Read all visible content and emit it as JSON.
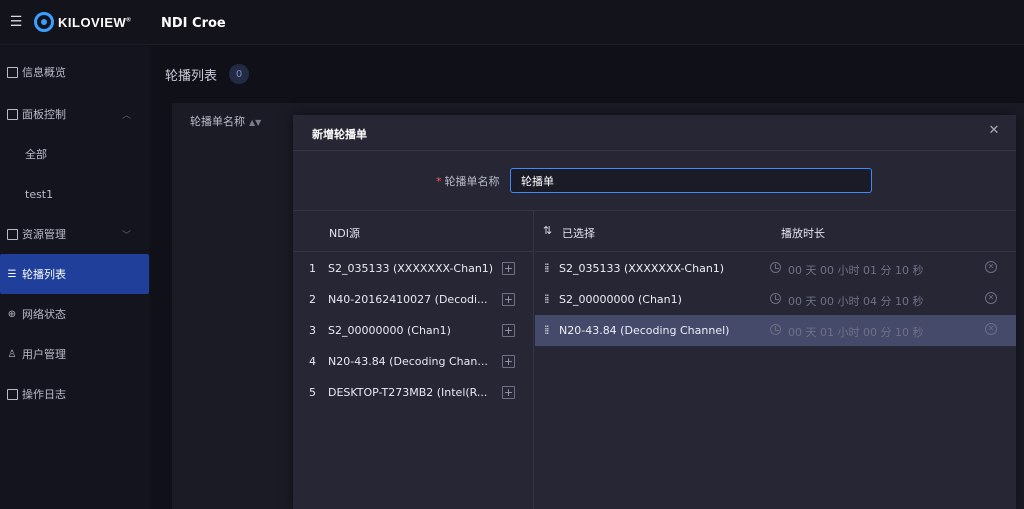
{
  "app": {
    "menu_icon": "menu-icon",
    "logo_text": "KILOVIEW",
    "logo_mark": "®",
    "title": "NDI Croe"
  },
  "sidebar": {
    "items": [
      {
        "label": "信息概览",
        "icon": "overview-icon"
      },
      {
        "label": "面板控制",
        "icon": "panel-icon"
      },
      {
        "label": "全部"
      },
      {
        "label": "test1"
      },
      {
        "label": "资源管理",
        "icon": "resource-icon"
      },
      {
        "label": "轮播列表",
        "icon": "playlist-icon"
      },
      {
        "label": "网络状态",
        "icon": "globe-icon"
      },
      {
        "label": "用户管理",
        "icon": "user-icon"
      },
      {
        "label": "操作日志",
        "icon": "log-icon"
      }
    ],
    "active": "轮播列表"
  },
  "page": {
    "title": "轮播列表",
    "count": "0",
    "column_name": "轮播单名称"
  },
  "modal": {
    "title": "新增轮播单",
    "form": {
      "name_label": "轮播单名称",
      "name_value": "轮播单"
    },
    "source_header": "NDI源",
    "sources": [
      {
        "num": "1",
        "name": "S2_035133 (XXXXXXX-Chan1)"
      },
      {
        "num": "2",
        "name": "N40-20162410027 (Decodi..."
      },
      {
        "num": "3",
        "name": "S2_00000000 (Chan1)"
      },
      {
        "num": "4",
        "name": "N20-43.84 (Decoding Chan..."
      },
      {
        "num": "5",
        "name": "DESKTOP-T273MB2 (Intel(R..."
      }
    ],
    "selected_header": "已选择",
    "duration_header": "播放时长",
    "selected": [
      {
        "name": "S2_035133 (XXXXXXX-Chan1)",
        "duration": "00 天 00 小时 01 分 10 秒"
      },
      {
        "name": "S2_00000000 (Chan1)",
        "duration": "00 天 00 小时 04 分 10 秒"
      },
      {
        "name": "N20-43.84 (Decoding Channel)",
        "duration": "00 天 01 小时 00 分 10 秒"
      }
    ],
    "highlighted_index": 2
  },
  "colors": {
    "accent": "#3b8bff",
    "active_nav": "#1f3f9a",
    "modal_bg": "#262635",
    "row_highlight": "#454a6a",
    "required": "#ff5a5a"
  }
}
